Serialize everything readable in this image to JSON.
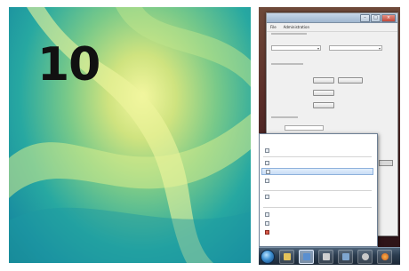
{
  "step": {
    "number": "10"
  },
  "wallpaper": {
    "colors": {
      "center": "#f4f7a0",
      "mid": "#78c989",
      "edge": "#147f93"
    }
  },
  "app_window": {
    "title": "",
    "menu": [
      "File",
      "Administration"
    ],
    "fields": [
      {
        "label": "",
        "value": ""
      },
      {
        "label": "",
        "value": ""
      }
    ],
    "buttons": [
      "",
      "",
      "",
      ""
    ],
    "dropdown_value": ""
  },
  "jumplist": {
    "header": "",
    "items": [
      "",
      "",
      "",
      "",
      "",
      "",
      "",
      ""
    ],
    "highlighted_index": 2
  },
  "taskbar": {
    "buttons": [
      {
        "icon": "folder-icon",
        "color": "#e4c35a"
      },
      {
        "icon": "app-window-icon",
        "color": "#5a8fd0",
        "active": true
      },
      {
        "icon": "media-icon",
        "color": "#d0d0d0"
      },
      {
        "icon": "document-icon",
        "color": "#7fa6cf"
      },
      {
        "icon": "gear-icon",
        "color": "#c9c9c9"
      },
      {
        "icon": "firefox-icon",
        "color": "#e07a2c"
      }
    ],
    "colors": {
      "bar": "#2a3b4e",
      "orb": "#3d8fd1"
    }
  }
}
